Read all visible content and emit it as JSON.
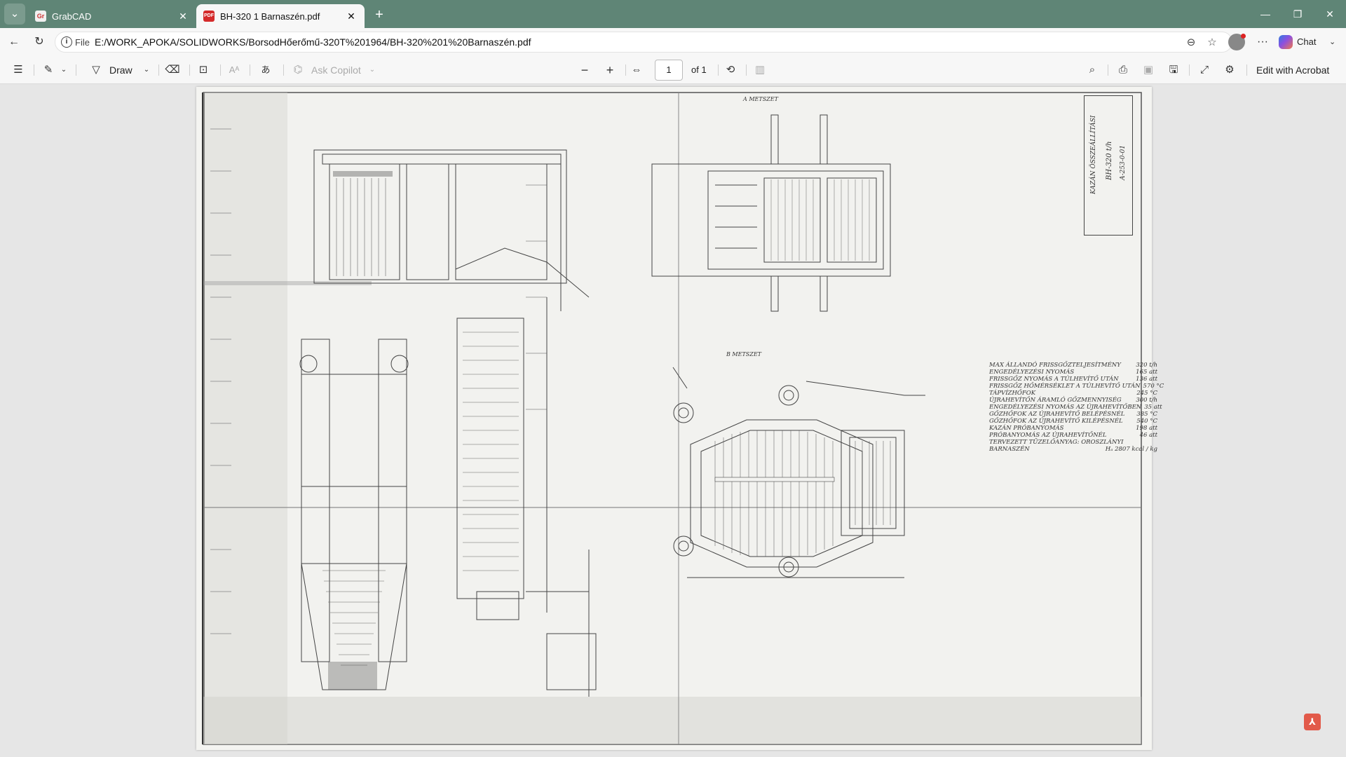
{
  "browser": {
    "tabs": [
      {
        "title": "GrabCAD",
        "favicon": "Gr",
        "active": false
      },
      {
        "title": "BH-320 1 Barnaszén.pdf",
        "favicon": "PDF",
        "active": true
      }
    ],
    "omnibox": {
      "scheme_label": "File",
      "url": "E:/WORK_APOKA/SOLIDWORKS/BorsodHőerőmű-320T%201964/BH-320%201%20Barnaszén.pdf"
    },
    "chat_label": "Chat"
  },
  "toolbar": {
    "draw_label": "Draw",
    "ask_copilot_label": "Ask Copilot",
    "page_number": "1",
    "page_count_label": "of 1",
    "edit_with_acrobat_label": "Edit with Acrobat"
  },
  "drawing": {
    "section_a_label": "A METSZET",
    "section_b_label": "B METSZET",
    "title_block_text": "BH-320 t/h",
    "title_block_number": "A-253-0-01",
    "title_block_name": "KAZÁN ÖSSZEÁLLÍTÁSI",
    "specs": [
      {
        "label": "MAX ÁLLANDÓ FRISSGŐZTELJESÍTMÉNY",
        "value": "320 t/h"
      },
      {
        "label": "ENGEDÉLYEZÉSI NYOMÁS",
        "value": "165 att"
      },
      {
        "label": "FRISSGŐZ NYOMÁS A TÚLHEVÍTŐ UTÁN",
        "value": "136 att"
      },
      {
        "label": "FRISSGŐZ HŐMÉRSÉKLET A TÚLHEVÍTŐ UTÁN",
        "value": "570 °C"
      },
      {
        "label": "TÁPVÍZHŐFOK",
        "value": "245 °C"
      },
      {
        "label": "ÚJRAHEVÍTŐN ÁRAMLÓ GŐZMENNYISÉG",
        "value": "300 t/h"
      },
      {
        "label": "ENGEDÉLYEZÉSI NYOMÁS AZ ÚJRAHEVÍTŐBEN",
        "value": "35 att"
      },
      {
        "label": "GŐZHŐFOK AZ ÚJRAHEVÍTŐ BELÉPÉSNÉL",
        "value": "385 °C"
      },
      {
        "label": "GŐZHŐFOK AZ ÚJRAHEVÍTŐ KILÉPÉSNÉL",
        "value": "540 °C"
      },
      {
        "label": "KAZÁN PRÓBANYOMÁS",
        "value": "198 att"
      },
      {
        "label": "PRÓBANYOMÁS AZ ÚJRAHEVÍTŐNÉL",
        "value": "46 att"
      },
      {
        "label": "TERVEZETT TÜZELŐANYAG: OROSZLÁNYI",
        "value": ""
      },
      {
        "label": "BARNASZÉN",
        "value": "Hₐ 2807 kcal / kg"
      }
    ]
  }
}
